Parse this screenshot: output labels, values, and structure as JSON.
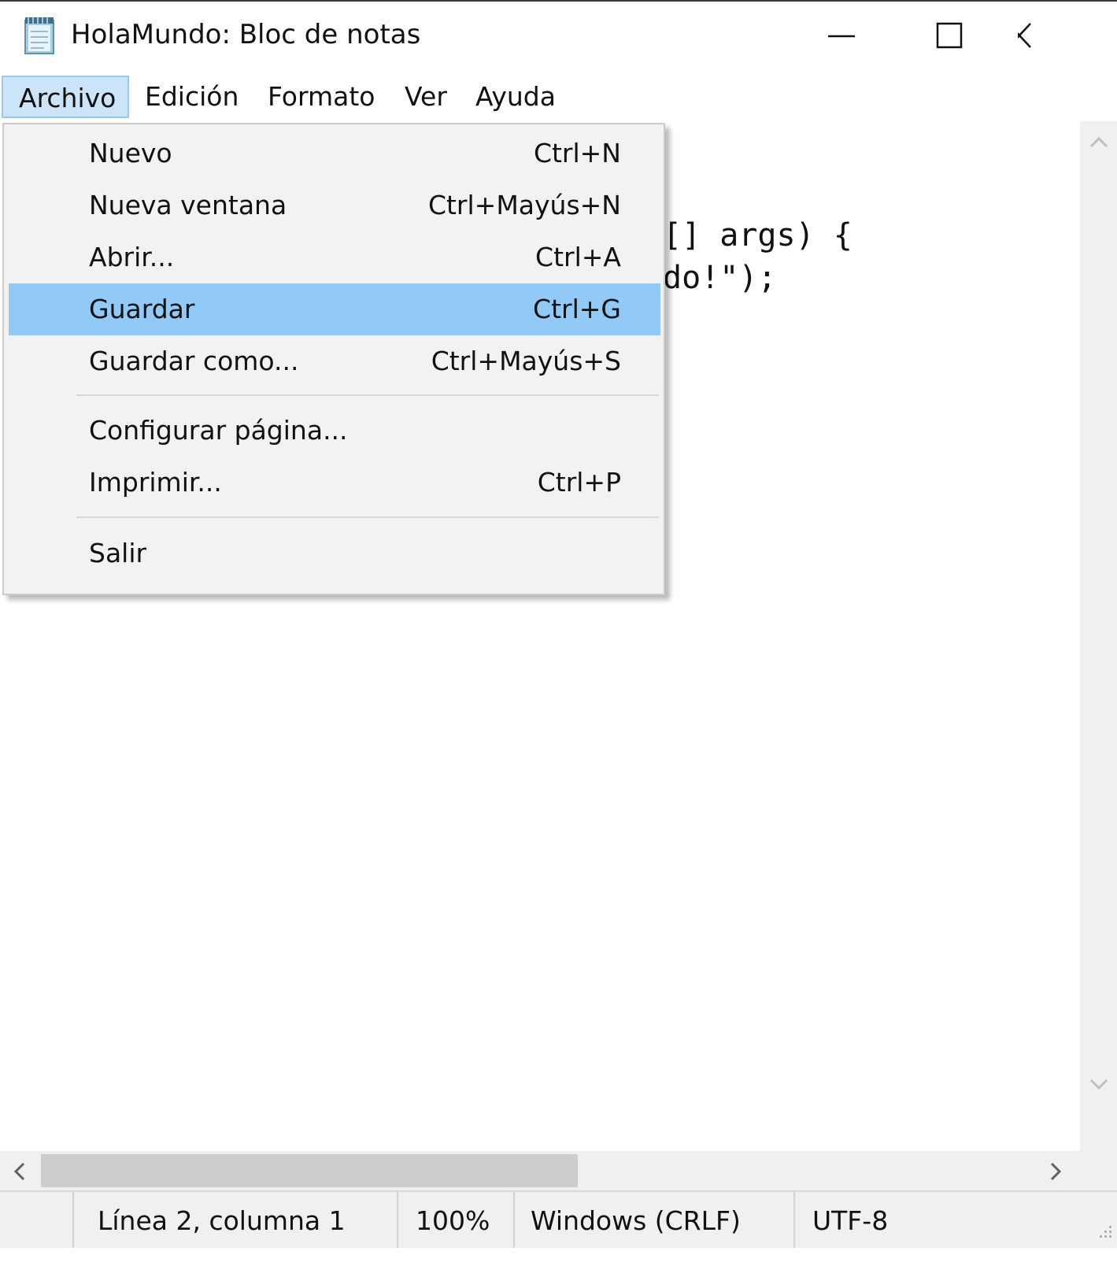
{
  "window": {
    "title": "HolaMundo: Bloc de notas"
  },
  "menubar": {
    "items": [
      {
        "label": "Archivo"
      },
      {
        "label": "Edición"
      },
      {
        "label": "Formato"
      },
      {
        "label": "Ver"
      },
      {
        "label": "Ayuda"
      }
    ]
  },
  "editor": {
    "visible_lines": [
      "[] args) {",
      "do!\");"
    ]
  },
  "file_menu": {
    "items": [
      {
        "label": "Nuevo",
        "shortcut": "Ctrl+N"
      },
      {
        "label": "Nueva ventana",
        "shortcut": "Ctrl+Mayús+N"
      },
      {
        "label": "Abrir...",
        "shortcut": "Ctrl+A"
      },
      {
        "label": "Guardar",
        "shortcut": "Ctrl+G"
      },
      {
        "label": "Guardar como...",
        "shortcut": "Ctrl+Mayús+S"
      },
      {
        "label": "Configurar página...",
        "shortcut": ""
      },
      {
        "label": "Imprimir...",
        "shortcut": "Ctrl+P"
      },
      {
        "label": "Salir",
        "shortcut": ""
      }
    ],
    "highlighted": "Guardar"
  },
  "statusbar": {
    "position": "Línea 2, columna 1",
    "zoom": "100%",
    "line_ending": "Windows (CRLF)",
    "encoding": "UTF-8"
  },
  "colors": {
    "menu_highlight": "#91c9f7",
    "menubar_active": "#cce4f7",
    "menu_background": "#f2f2f2"
  }
}
